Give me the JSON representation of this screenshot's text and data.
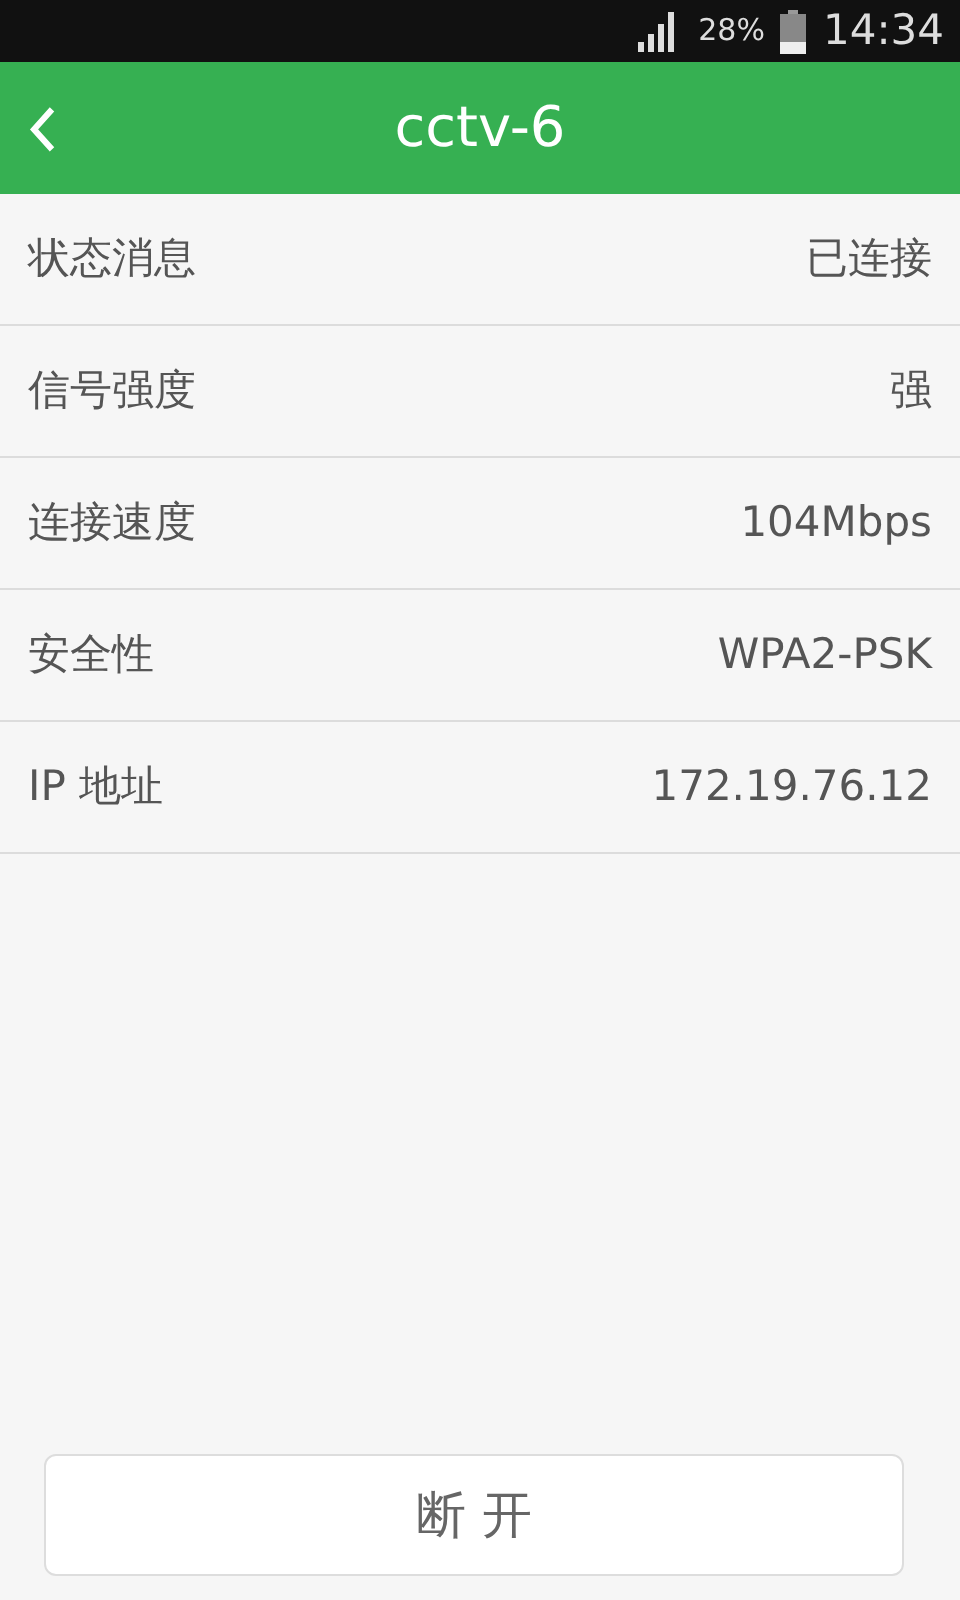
{
  "status_bar": {
    "battery": "28%",
    "time": "14:34"
  },
  "header": {
    "title": "cctv-6"
  },
  "rows": [
    {
      "label": "状态消息",
      "value": "已连接"
    },
    {
      "label": "信号强度",
      "value": "强"
    },
    {
      "label": "连接速度",
      "value": "104Mbps"
    },
    {
      "label": "安全性",
      "value": "WPA2-PSK"
    },
    {
      "label": "IP 地址",
      "value": "172.19.76.12"
    }
  ],
  "button": {
    "label": "断 开"
  }
}
